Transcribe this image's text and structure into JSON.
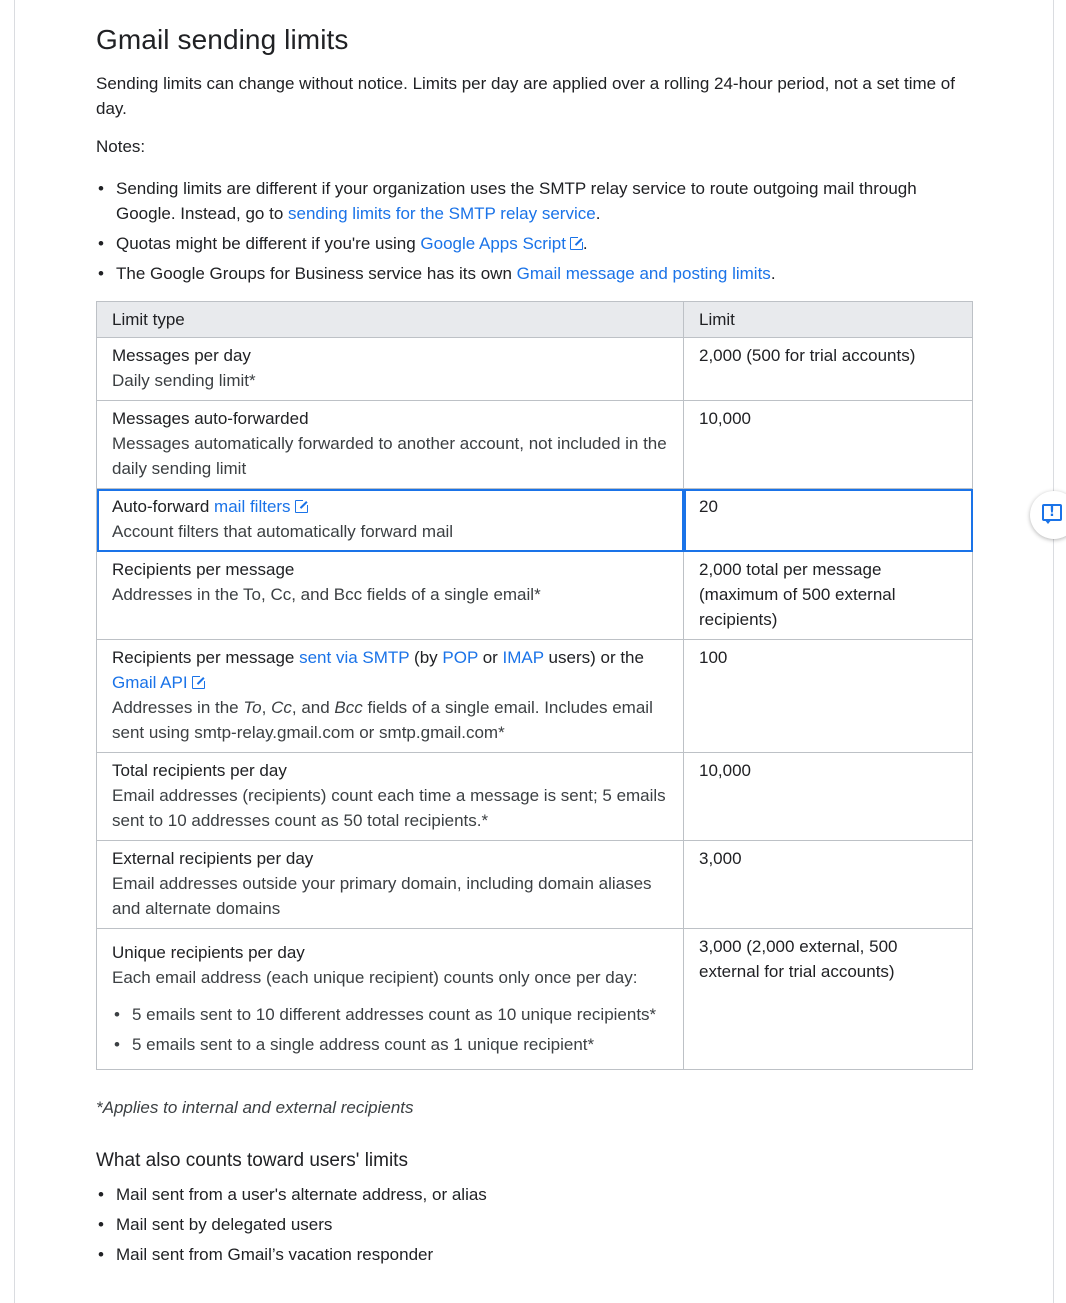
{
  "page": {
    "title": "Gmail sending limits",
    "intro": "Sending limits can change without notice. Limits per day are applied over a rolling 24-hour period, not a set time of day.",
    "notes_label": "Notes:",
    "notes": {
      "n1_pre": "Sending limits are different if your organization uses the SMTP relay service to route outgoing mail through Google. Instead, go to ",
      "n1_link": "sending limits for the SMTP relay service",
      "n1_post": ".",
      "n2_pre": "Quotas might be different if you're using ",
      "n2_link": "Google Apps Script",
      "n2_post": ".",
      "n3_pre": "The Google Groups for Business service has its own ",
      "n3_link": "Gmail message and posting limits",
      "n3_post": "."
    }
  },
  "table": {
    "headers": {
      "type": "Limit type",
      "limit": "Limit"
    },
    "rows": {
      "r1": {
        "title": "Messages per day",
        "desc": "Daily sending limit*",
        "limit": "2,000 (500 for trial accounts)"
      },
      "r2": {
        "title": "Messages auto-forwarded",
        "desc": "Messages automatically forwarded to another account, not included in the daily sending limit",
        "limit": "10,000"
      },
      "r3": {
        "title_pre": "Auto-forward ",
        "title_link": "mail filters",
        "desc": "Account filters that automatically forward mail",
        "limit": "20"
      },
      "r4": {
        "title": "Recipients per message",
        "desc": "Addresses in the To, Cc, and Bcc fields of a single email*",
        "limit": "2,000 total per message (maximum of 500 external recipients)"
      },
      "r5": {
        "t1": "Recipients per message ",
        "link_smtp": "sent via SMTP",
        "t2": " (by ",
        "link_pop": "POP",
        "t3": " or ",
        "link_imap": "IMAP",
        "t4": " users) or the ",
        "link_api": "Gmail API",
        "d1": "Addresses in the ",
        "d_to": "To",
        "d2": ", ",
        "d_cc": "Cc",
        "d3": ", and ",
        "d_bcc": "Bcc",
        "d4": " fields of a single email. Includes email sent using smtp-relay.gmail.com or smtp.gmail.com*",
        "limit": "100"
      },
      "r6": {
        "title": "Total recipients per day",
        "desc": "Email addresses (recipients) count each time a message is sent; 5 emails sent to 10 addresses count as 50 total recipients.*",
        "limit": "10,000"
      },
      "r7": {
        "title": "External recipients per day",
        "desc": "Email addresses outside your primary domain, including domain aliases and alternate domains",
        "limit": "3,000"
      },
      "r8": {
        "title": "Unique recipients per day",
        "desc": "Each email address (each unique recipient) counts only once per day:",
        "b1": "5 emails sent to 10 different addresses count as 10 unique recipients*",
        "b2": "5 emails sent to a single address count as 1 unique recipient*",
        "limit": "3,000 (2,000 external, 500 external for trial accounts)"
      }
    }
  },
  "footnote": "*Applies to internal and external recipients",
  "also": {
    "heading": "What also counts toward users' limits",
    "i1": "Mail sent from a user's alternate address, or alias",
    "i2": "Mail sent by delegated users",
    "i3": "Mail sent from Gmail’s vacation responder"
  },
  "feedback": {
    "icon": "feedback-icon",
    "mark": "!"
  },
  "colors": {
    "link": "#1a73e8",
    "header_bg": "#e8eaed",
    "border": "#bdc1c6",
    "highlight": "#1a73e8"
  }
}
